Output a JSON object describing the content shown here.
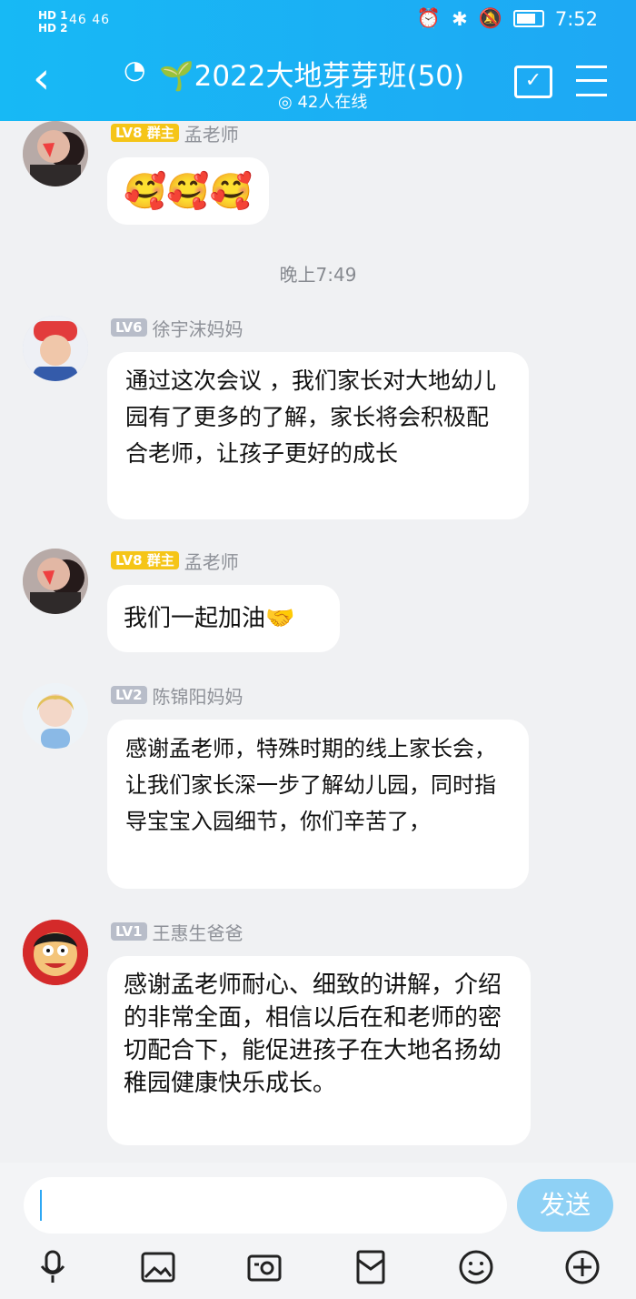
{
  "status_bar": {
    "hd1": "HD 1",
    "hd2": "HD 2",
    "signal": "46 46",
    "time": "7:52"
  },
  "header": {
    "title": "🌱2022大地芽芽班(50)",
    "online": "42人在线"
  },
  "chat": {
    "time_divider": "晚上7:49",
    "messages": [
      {
        "level": "LV8",
        "role": "群主",
        "name": "孟老师",
        "text": "🥰🥰🥰"
      },
      {
        "level": "LV6",
        "name": "徐宇沫妈妈",
        "text": "通过这次会议 ，我们家长对大地幼儿园有了更多的了解，家长将会积极配合老师，让孩子更好的成长"
      },
      {
        "level": "LV8",
        "role": "群主",
        "name": "孟老师",
        "text": "我们一起加油🤝"
      },
      {
        "level": "LV2",
        "name": "陈锦阳妈妈",
        "text": "感谢孟老师，特殊时期的线上家长会，让我们家长深一步了解幼儿园，同时指导宝宝入园细节，你们辛苦了，"
      },
      {
        "level": "LV1",
        "name": "王惠生爸爸",
        "text": "感谢孟老师耐心、细致的讲解，介绍的非常全面，相信以后在和老师的密切配合下，能促进孩子在大地名扬幼稚园健康快乐成长。"
      }
    ]
  },
  "input": {
    "send_label": "发送"
  },
  "icons": [
    "back-icon",
    "ear-icon",
    "calendar-icon",
    "menu-icon",
    "microphone-icon",
    "image-icon",
    "camera-icon",
    "red-packet-icon",
    "emoji-icon",
    "plus-icon"
  ]
}
